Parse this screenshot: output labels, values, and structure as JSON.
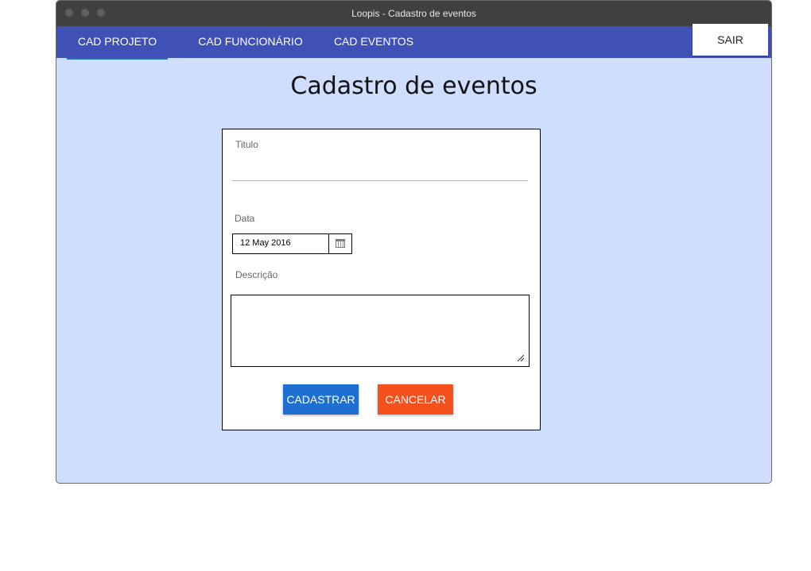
{
  "window": {
    "title": "Loopis - Cadastro de eventos"
  },
  "nav": {
    "tabs": [
      {
        "label": "CAD PROJETO",
        "active": true
      },
      {
        "label": "CAD FUNCIONÁRIO",
        "active": false
      },
      {
        "label": "CAD EVENTOS",
        "active": false
      }
    ],
    "logout_label": "SAIR"
  },
  "page": {
    "title": "Cadastro de eventos"
  },
  "form": {
    "titulo": {
      "label": "Titulo",
      "value": ""
    },
    "data": {
      "label": "Data",
      "value": "12 May 2016"
    },
    "descricao": {
      "label": "Descrição",
      "value": ""
    },
    "submit_label": "CADASTRAR",
    "cancel_label": "CANCELAR"
  },
  "colors": {
    "navbar": "#3f51b5",
    "background": "#d0defd",
    "primary_button": "#1e6fcf",
    "cancel_button": "#f4511e"
  },
  "icons": {
    "date_picker": "calendar-icon",
    "textarea_resize": "resize-handle-icon"
  }
}
